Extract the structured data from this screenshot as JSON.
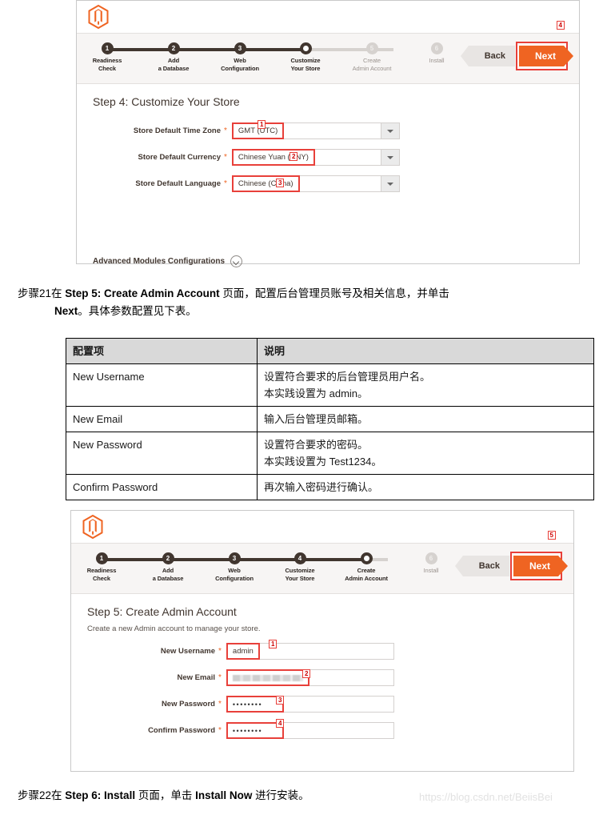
{
  "panel1": {
    "logo_alt": "Magento",
    "annotation": "4",
    "stepper": {
      "steps": [
        {
          "num": "1",
          "line1": "Readiness",
          "line2": "Check",
          "state": "done"
        },
        {
          "num": "2",
          "line1": "Add",
          "line2": "a Database",
          "state": "done"
        },
        {
          "num": "3",
          "line1": "Web",
          "line2": "Configuration",
          "state": "done"
        },
        {
          "num": "4",
          "line1": "Customize",
          "line2": "Your Store",
          "state": "current"
        },
        {
          "num": "5",
          "line1": "Create",
          "line2": "Admin Account",
          "state": "todo"
        },
        {
          "num": "6",
          "line1": "Install",
          "line2": "",
          "state": "todo"
        }
      ],
      "back_label": "Back",
      "next_label": "Next"
    },
    "title": "Step 4: Customize Your Store",
    "fields": [
      {
        "label": "Store Default Time Zone",
        "required": "*",
        "value": "GMT (UTC)",
        "badge": "1"
      },
      {
        "label": "Store Default Currency",
        "required": "*",
        "value": "Chinese Yuan (CNY)",
        "badge": "2"
      },
      {
        "label": "Store Default Language",
        "required": "*",
        "value": "Chinese (China)",
        "badge": "3"
      }
    ],
    "advanced_label": "Advanced Modules Configurations"
  },
  "step21": {
    "prefix": "步骤21",
    "line1_a": "在 ",
    "line1_bold": "Step 5: Create Admin Account",
    "line1_b": " 页面，配置后台管理员账号及相关信息，并单击",
    "line2_bold": "Next",
    "line2_b": "。具体参数配置见下表。"
  },
  "table": {
    "headers": [
      "配置项",
      "说明"
    ],
    "rows": [
      {
        "item": "New Username",
        "desc1": "设置符合要求的后台管理员用户名。",
        "desc2": "本实践设置为 admin。"
      },
      {
        "item": "New Email",
        "desc1": "输入后台管理员邮箱。",
        "desc2": ""
      },
      {
        "item": "New Password",
        "desc1": "设置符合要求的密码。",
        "desc2": "本实践设置为 Test1234。"
      },
      {
        "item": "Confirm Password",
        "desc1": "再次输入密码进行确认。",
        "desc2": ""
      }
    ]
  },
  "panel2": {
    "logo_alt": "Magento",
    "annotation": "5",
    "stepper": {
      "steps": [
        {
          "num": "1",
          "line1": "Readiness",
          "line2": "Check",
          "state": "done"
        },
        {
          "num": "2",
          "line1": "Add",
          "line2": "a Database",
          "state": "done"
        },
        {
          "num": "3",
          "line1": "Web",
          "line2": "Configuration",
          "state": "done"
        },
        {
          "num": "4",
          "line1": "Customize",
          "line2": "Your Store",
          "state": "done"
        },
        {
          "num": "5",
          "line1": "Create",
          "line2": "Admin Account",
          "state": "current"
        },
        {
          "num": "6",
          "line1": "Install",
          "line2": "",
          "state": "todo"
        }
      ],
      "back_label": "Back",
      "next_label": "Next"
    },
    "title": "Step 5: Create Admin Account",
    "subtitle": "Create a new Admin account to manage your store.",
    "fields": [
      {
        "label": "New Username",
        "required": "*",
        "value": "admin",
        "badge": "1",
        "kind": "text"
      },
      {
        "label": "New Email",
        "required": "*",
        "value": "",
        "badge": "2",
        "kind": "redacted"
      },
      {
        "label": "New Password",
        "required": "*",
        "value": "••••••••",
        "badge": "3",
        "kind": "password"
      },
      {
        "label": "Confirm Password",
        "required": "*",
        "value": "••••••••",
        "badge": "4",
        "kind": "password"
      }
    ]
  },
  "step22": {
    "prefix": "步骤22",
    "a": "在 ",
    "bold1": "Step 6: Install",
    "b": " 页面，单击 ",
    "bold2": "Install Now",
    "c": " 进行安装。"
  },
  "watermark": "https://blog.csdn.net/BeiisBei",
  "colors": {
    "magento_orange": "#ef6422",
    "annotation_red": "#e8403a",
    "stepper_dark": "#41362f",
    "stepper_gray": "#d6d2cf",
    "table_header_bg": "#d9d9d9"
  }
}
